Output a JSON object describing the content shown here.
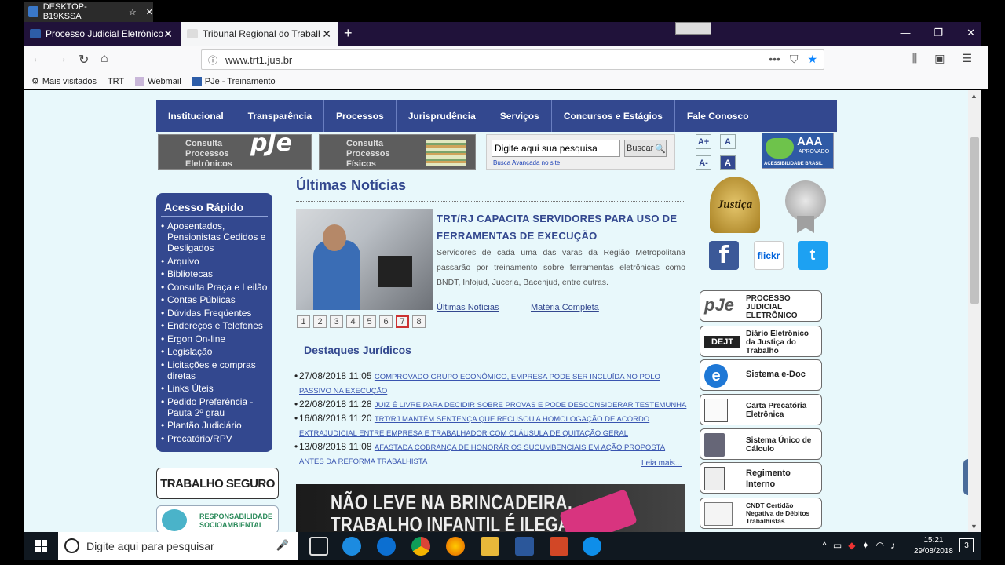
{
  "rdp": {
    "tab_label": "DESKTOP-B19KSSA"
  },
  "browser": {
    "tabs": [
      {
        "label": "Processo Judicial Eletrônico: Ac"
      },
      {
        "label": "Tribunal Regional do Trabalho"
      }
    ],
    "url": "www.trt1.jus.br",
    "bookmarks": [
      "Mais visitados",
      "TRT",
      "Webmail",
      "PJe - Treinamento"
    ]
  },
  "site": {
    "menu": [
      "Institucional",
      "Transparência",
      "Processos",
      "Jurisprudência",
      "Serviços",
      "Concursos e Estágios",
      "Fale Conosco"
    ],
    "consulta_pje": {
      "text": "Consulta Processos Eletrônicos",
      "logo": "pJe"
    },
    "consulta_fisicos": {
      "text": "Consulta Processos Físicos"
    },
    "search": {
      "placeholder": "Digite aqui sua pesquisa",
      "button": "Buscar",
      "advanced": "Busca Avançada no site"
    },
    "font_controls": [
      "A+",
      "A",
      "A-",
      "A"
    ],
    "acessibilidade": {
      "aaa": "AAA",
      "aprovado": "APROVADO",
      "label": "ACESSIBILIDADE BRASIL"
    },
    "quick_access": {
      "title": "Acesso Rápido",
      "items": [
        "Aposentados, Pensionistas Cedidos e Desligados",
        "Arquivo",
        "Bibliotecas",
        "Consulta Praça e Leilão",
        "Contas Públicas",
        "Dúvidas Freqüentes",
        "Endereços e Telefones",
        "Ergon On-line",
        "Legislação",
        "Licitações e compras diretas",
        "Links Úteis",
        "Pedido Preferência - Pauta 2º grau",
        "Plantão Judiciário",
        "Precatório/RPV"
      ]
    },
    "trabalho_seguro": "TRABALHO SEGURO",
    "responsabilidade": "RESPONSABILIDADE SOCIOAMBIENTAL",
    "news": {
      "heading": "Últimas Notícias",
      "title": "TRT/RJ CAPACITA SERVIDORES PARA USO DE FERRAMENTAS DE EXECUÇÃO",
      "summary": "Servidores de cada uma das varas da Região Metropolitana passarão por treinamento sobre ferramentas eletrônicas como BNDT, Infojud, Jucerja, Bacenjud, entre outras.",
      "link_ultimas": "Últimas Notícias",
      "link_materia": "Matéria Completa",
      "pages": [
        "1",
        "2",
        "3",
        "4",
        "5",
        "6",
        "7",
        "8"
      ],
      "active_page": "7"
    },
    "destaques": {
      "heading": "Destaques Jurídicos",
      "items": [
        {
          "date": "27/08/2018 11:05",
          "text": "COMPROVADO GRUPO ECONÔMICO, EMPRESA PODE SER INCLUÍDA NO POLO PASSIVO NA EXECUÇÃO"
        },
        {
          "date": "22/08/2018 11:28",
          "text": "JUIZ É LIVRE PARA DECIDIR SOBRE PROVAS E PODE DESCONSIDERAR TESTEMUNHA"
        },
        {
          "date": "16/08/2018 11:20",
          "text": "TRT/RJ MANTÉM SENTENÇA QUE RECUSOU A HOMOLOGAÇÃO DE ACORDO EXTRAJUDICIAL ENTRE EMPRESA E TRABALHADOR COM CLÁUSULA DE QUITAÇÃO GERAL"
        },
        {
          "date": "13/08/2018 11:08",
          "text": "AFASTADA COBRANÇA DE HONORÁRIOS SUCUMBENCIAIS EM AÇÃO PROPOSTA ANTES DA REFORMA TRABALHISTA"
        }
      ],
      "leia_mais": "Leia mais..."
    },
    "banner": {
      "line1": "NÃO LEVE NA BRINCADEIRA.",
      "line2": "TRABALHO INFANTIL É ILEGAL."
    },
    "selo": "Justiça",
    "social": {
      "facebook": "f",
      "flickr": "flickr",
      "twitter": "t"
    },
    "services": [
      {
        "label": "PROCESSO JUDICIAL ELETRÔNICO"
      },
      {
        "label": "Diário Eletrônico da Justiça do Trabalho"
      },
      {
        "label": "Sistema e-Doc"
      },
      {
        "label": "Carta Precatória Eletrônica"
      },
      {
        "label": "Sistema Único de Cálculo"
      },
      {
        "label": "Regimento Interno"
      },
      {
        "label": "CNDT Certidão Negativa de Débitos Trabalhistas"
      }
    ]
  },
  "taskbar": {
    "search_placeholder": "Digite aqui para pesquisar",
    "time": "15:21",
    "date": "29/08/2018",
    "notifications": "3"
  }
}
